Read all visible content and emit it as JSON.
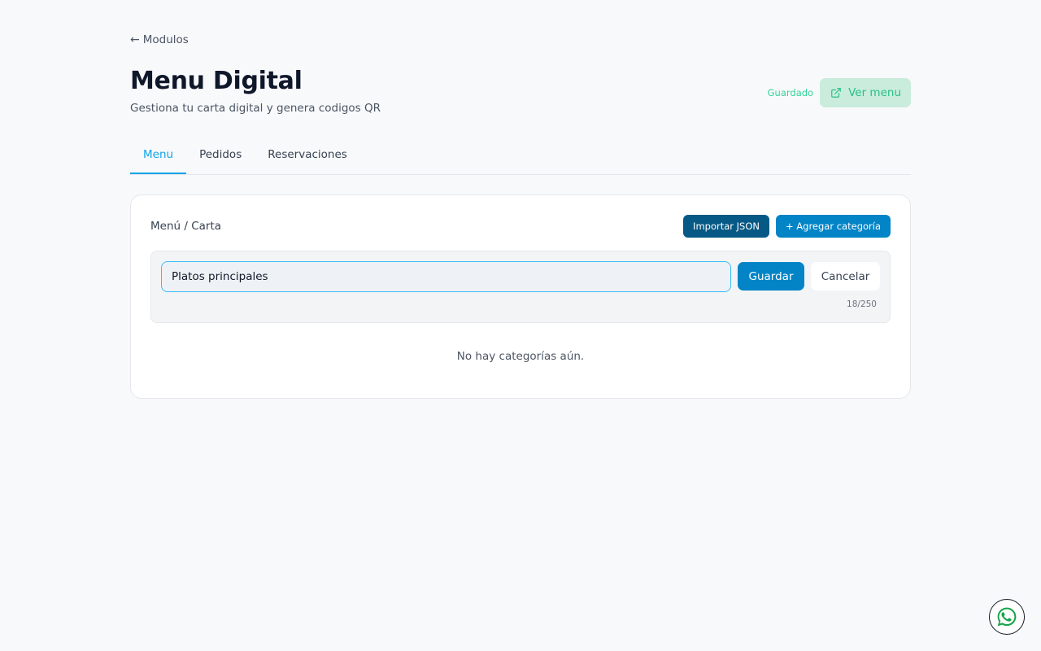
{
  "nav": {
    "back_label": "Modulos",
    "back_icon": "arrow-left-icon"
  },
  "header": {
    "title": "Menu Digital",
    "subtitle": "Gestiona tu carta digital y genera codigos QR",
    "status": "Guardado",
    "view_button": "Ver menu",
    "view_icon": "external-link-icon"
  },
  "tabs": [
    {
      "label": "Menu",
      "active": true
    },
    {
      "label": "Pedidos",
      "active": false
    },
    {
      "label": "Reservaciones",
      "active": false
    }
  ],
  "card": {
    "title": "Menú / Carta",
    "import_button": "Importar JSON",
    "add_button": "+ Agregar categoría",
    "editor": {
      "input_value": "Platos principales",
      "save_button": "Guardar",
      "cancel_button": "Cancelar",
      "char_count": "18/250"
    },
    "empty_message": "No hay categorías aún."
  },
  "floating": {
    "icon": "whatsapp-icon"
  },
  "colors": {
    "accent": "#0ea5e9",
    "primary_button": "#0284c7",
    "dark_button": "#075985",
    "success": "#34d399"
  }
}
